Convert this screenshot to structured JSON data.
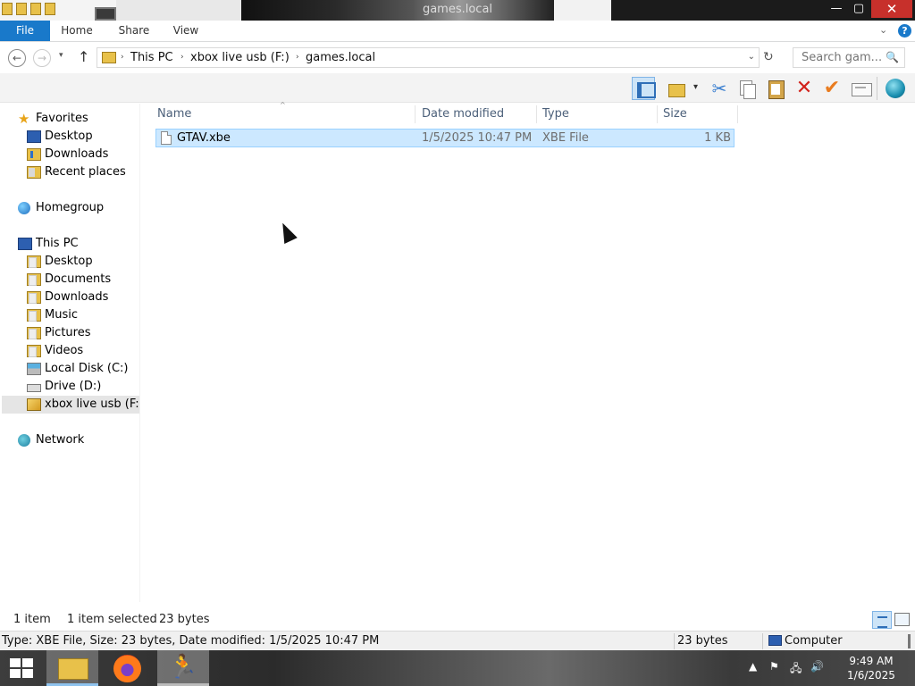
{
  "window": {
    "title": "games.local",
    "controls": {
      "minimize": "—",
      "maximize": "▢",
      "close": "✕"
    }
  },
  "ribbon": {
    "tabs": [
      "File",
      "Home",
      "Share",
      "View"
    ],
    "help": "?",
    "collapse": "⌄"
  },
  "address": {
    "crumbs": [
      "This PC",
      "xbox live usb (F:)",
      "games.local"
    ],
    "separator": "›",
    "search_placeholder": "Search gam...",
    "nav": {
      "back": "←",
      "forward": "→",
      "recent": "▾",
      "up": "↑",
      "refresh": "↻",
      "dropdown": "⌄",
      "search_glyph": "🔍"
    }
  },
  "navpane": {
    "favorites": {
      "label": "Favorites",
      "items": [
        "Desktop",
        "Downloads",
        "Recent places"
      ]
    },
    "homegroup": "Homegroup",
    "thispc": {
      "label": "This PC",
      "items": [
        "Desktop",
        "Documents",
        "Downloads",
        "Music",
        "Pictures",
        "Videos",
        "Local Disk (C:)",
        "Drive (D:)",
        "xbox live usb (F:)"
      ]
    },
    "network": "Network",
    "selected": "xbox live usb (F:)"
  },
  "filelist": {
    "columns": [
      "Name",
      "Date modified",
      "Type",
      "Size"
    ],
    "sort_glyph": "^",
    "rows": [
      {
        "name": "GTAV.xbe",
        "date": "1/5/2025 10:47 PM",
        "type": "XBE File",
        "size": "1 KB",
        "selected": true
      }
    ]
  },
  "statusbar": {
    "count": "1 item",
    "selection": "1 item selected",
    "bytes": "23 bytes"
  },
  "statusbar2": {
    "details": "Type: XBE File, Size: 23 bytes, Date modified: 1/5/2025 10:47 PM",
    "size": "23 bytes",
    "location": "Computer"
  },
  "taskbar": {
    "time": "9:49 AM",
    "date": "1/6/2025",
    "tray": {
      "chevron": "▲",
      "flag": "⚑",
      "network": "🖧",
      "volume": "🔊"
    },
    "runner_glyph": "🏃"
  },
  "colors": {
    "accent": "#1979ca",
    "selection_fill": "#cce8ff",
    "selection_border": "#99d1ff",
    "close_button": "#c7302b"
  }
}
